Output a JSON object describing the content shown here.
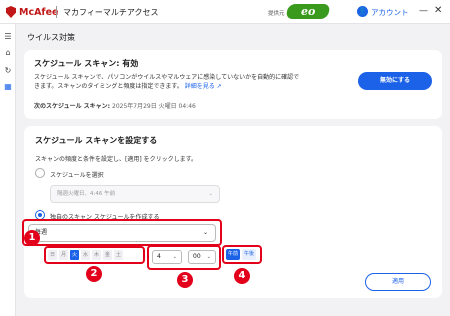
{
  "titlebar": {
    "brand": "McAfee",
    "app_title": "マカフィーマルチアクセス",
    "provided_by": "提供元",
    "partner_logo_text": "eo",
    "account_label": "アカウント",
    "minimize": "—",
    "close": "✕"
  },
  "sidebar": {
    "icons": [
      "menu-icon",
      "home-icon",
      "shield-refresh-icon",
      "apps-grid-icon"
    ]
  },
  "page_title": "ウイルス対策",
  "scheduled_scan": {
    "title": "スケジュール スキャン: 有効",
    "desc_line1": "スケジュール スキャンで、パソコンがウイルスやマルウェアに感染していないかを自動的に確認で",
    "desc_line2": "きます。スキャンのタイミングと頻度は指定できます。",
    "detail_link": "詳細を見る ↗",
    "next_label": "次のスケジュール スキャン:",
    "next_date": "2025年7月29日 火曜日 04:46",
    "disable_button": "無効にする"
  },
  "configure": {
    "title": "スケジュール スキャンを設定する",
    "desc": "スキャンの頻度と条件を設定し、[適用] をクリックします。",
    "option_select_label": "スケジュールを選択",
    "option_select_value": "隔週火曜日、4:46 午前",
    "option_custom_label": "独自のスキャン スケジュールを作成する",
    "frequency_value": "毎週",
    "days": [
      "日",
      "月",
      "火",
      "水",
      "木",
      "金",
      "土"
    ],
    "selected_day_index": 2,
    "hour_value": "4",
    "minute_value": "00",
    "am_label": "午前",
    "pm_label": "午後",
    "apply_button": "適用"
  },
  "annotations": {
    "badge1": "1",
    "badge2": "2",
    "badge3": "3",
    "badge4": "4",
    "highlight_color": "#e3001b"
  },
  "colors": {
    "accent": "#1b62e8",
    "brand_red": "#c01818",
    "partner_green": "#3a9a1e"
  }
}
